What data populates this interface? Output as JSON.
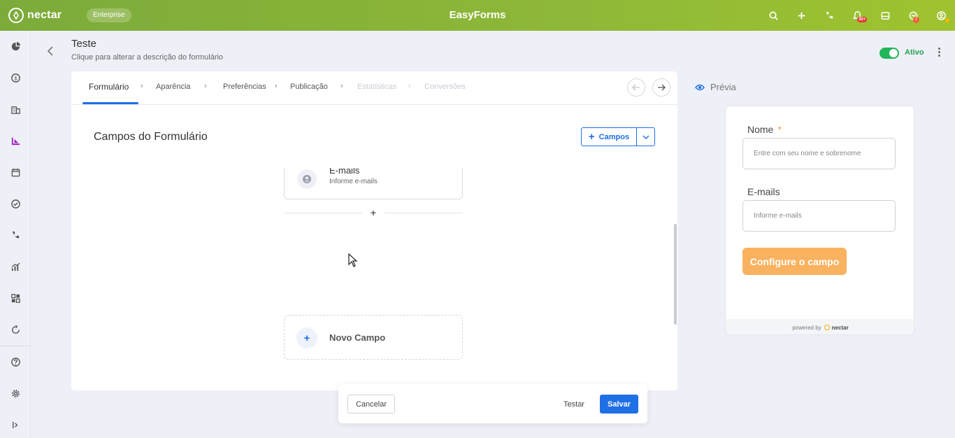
{
  "topbar": {
    "logo_text": "nectar",
    "plan_badge": "Enterprise",
    "app_title": "EasyForms",
    "notification_count": "30+",
    "alert_count": "1",
    "icons": [
      "search-icon",
      "plus-icon",
      "phone-icon",
      "bell-icon",
      "inbox-icon",
      "chat-icon",
      "user-icon"
    ],
    "colors": {
      "gradient_start": "#7cab3a",
      "gradient_end": "#9fc32f"
    }
  },
  "sidebar": {
    "items": [
      "dashboard-icon",
      "dollar-icon",
      "building-icon",
      "forms-icon",
      "calendar-icon",
      "check-icon",
      "phone-icon",
      "chart-icon",
      "apps-icon",
      "sync-icon",
      "help-icon",
      "settings-icon",
      "expand-icon"
    ],
    "active": "forms-icon",
    "active_color": "#a020c0"
  },
  "form": {
    "title": "Teste",
    "description": "Clique para alterar a descrição do formulário",
    "status_label": "Ativo",
    "status_active": true
  },
  "steps": [
    {
      "label": "Formulário",
      "state": "current"
    },
    {
      "label": "Aparência",
      "state": "enabled"
    },
    {
      "label": "Preferências",
      "state": "enabled"
    },
    {
      "label": "Publicação",
      "state": "enabled"
    },
    {
      "label": "Estatísticas",
      "state": "disabled"
    },
    {
      "label": "Conversões",
      "state": "disabled"
    }
  ],
  "editor": {
    "section_title": "Campos do Formulário",
    "add_fields_label": "Campos",
    "fields": [
      {
        "title": "E-mails",
        "subtitle": "Informe e-mails"
      }
    ],
    "new_field_label": "Novo Campo"
  },
  "actions": {
    "cancel": "Cancelar",
    "test": "Testar",
    "save": "Salvar"
  },
  "preview": {
    "header": "Prévia",
    "fields": [
      {
        "label": "Nome",
        "required": true,
        "placeholder": "Entre com seu nome e sobrenome"
      },
      {
        "label": "E-mails",
        "required": false,
        "placeholder": "Informe e-mails"
      }
    ],
    "button_label": "Configure o campo",
    "footer_prefix": "powered by",
    "footer_brand": "nectar",
    "button_color": "#f9b25f"
  },
  "accent_color": "#1f6fe5"
}
